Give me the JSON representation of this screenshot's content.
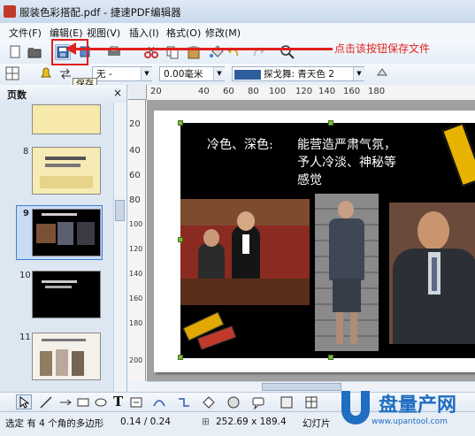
{
  "window": {
    "title": "服装色彩搭配.pdf - 捷速PDF编辑器"
  },
  "menu": [
    "文件(F)",
    "编辑(E)",
    "视图(V)",
    "插入(I)",
    "格式(O)",
    "修改(M)"
  ],
  "toolbar2": {
    "font_value": "无 -",
    "line_width": "0.00毫米",
    "color_name": "探戈舞: 青天色 2"
  },
  "annotation": {
    "text": "点击该按钮保存文件"
  },
  "tooltip": {
    "text": "保存"
  },
  "pages_panel": {
    "title": "页数",
    "close": "×",
    "thumbnails": [
      {
        "number": "8",
        "selected": false
      },
      {
        "number": "9",
        "selected": true
      },
      {
        "number": "10",
        "selected": false
      },
      {
        "number": "11",
        "selected": false
      }
    ]
  },
  "ruler": {
    "h_ticks": [
      "20",
      "40",
      "60",
      "80",
      "100",
      "120",
      "140",
      "160",
      "180"
    ],
    "v_ticks": [
      "20",
      "40",
      "60",
      "80",
      "100",
      "120",
      "140",
      "160",
      "180",
      "200"
    ]
  },
  "slide": {
    "heading_left": "冷色、深色:",
    "lines": [
      "能营造严肃气氛，",
      "予人冷淡、神秘等",
      "感觉"
    ]
  },
  "status": {
    "selection": "选定 有 4 个角的多边形",
    "coords": "0.14 / 0.24",
    "size": "252.69 x 189.4",
    "slide_label": "幻灯片"
  },
  "watermark": {
    "brand": "盘量产网",
    "url": "www.upantool.com"
  },
  "colors": {
    "accent_red": "#e0201c",
    "selection_blue": "#3b7fd4",
    "color_swatch": "#2f5e9c"
  }
}
